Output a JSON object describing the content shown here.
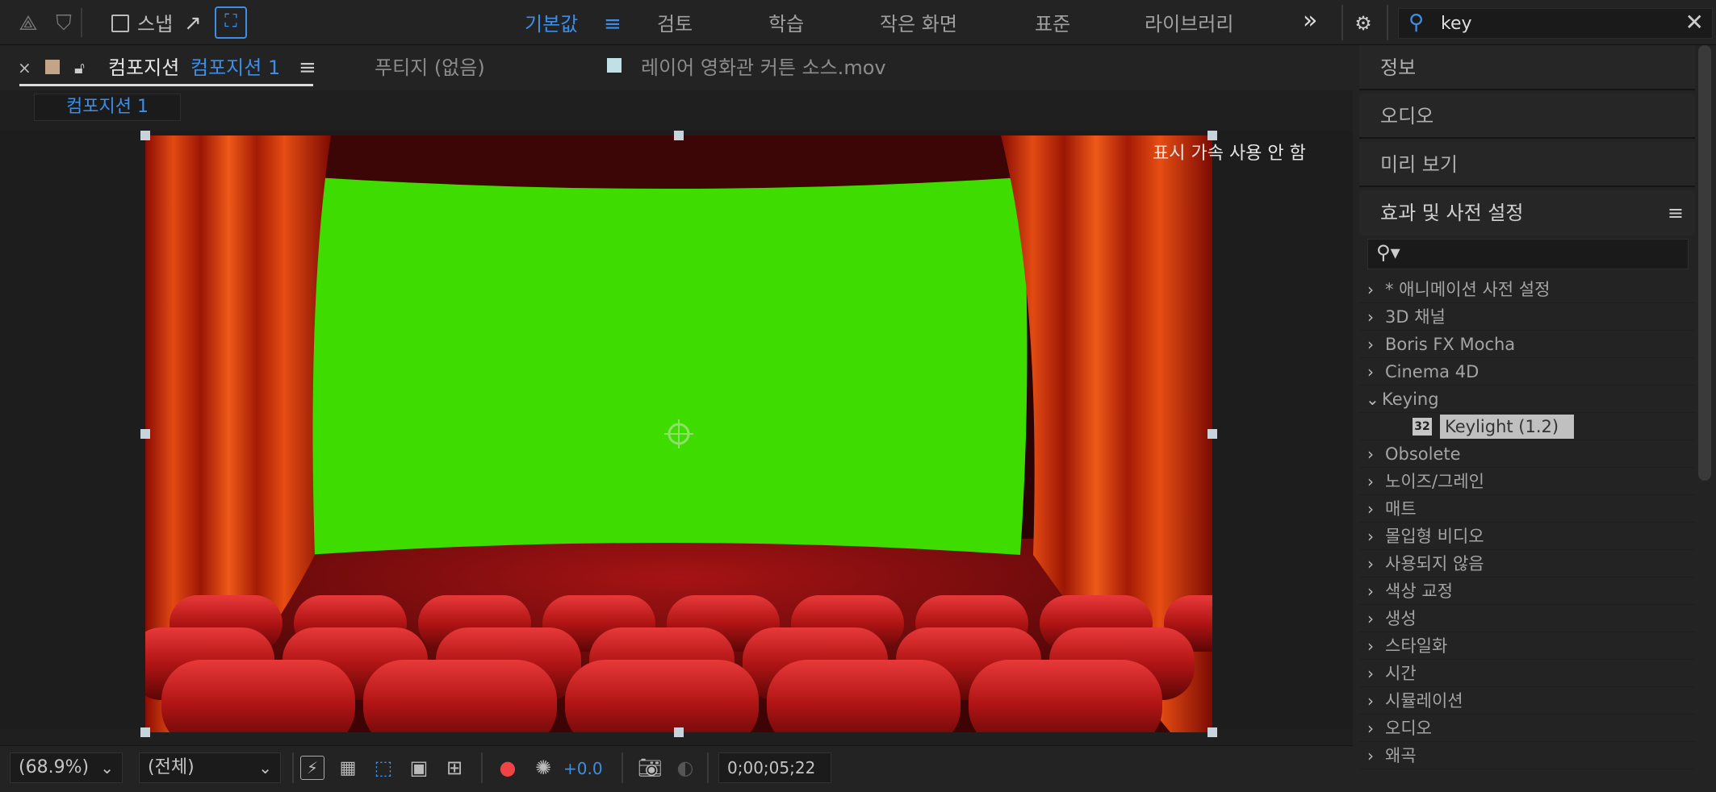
{
  "toolbar": {
    "snap_label": "스냅",
    "workspaces": [
      "기본값",
      "검토",
      "학습",
      "작은 화면",
      "표준",
      "라이브러리"
    ],
    "active_workspace": "기본값",
    "more_label": "»",
    "search_value": "key"
  },
  "comp_panel": {
    "tab_name": "컴포지션",
    "tab_comp": "컴포지션 1",
    "footage_tab": "푸티지 (없음)",
    "layer_tab": "레이어 영화관 커튼 소스.mov",
    "sub_tab": "컴포지션 1",
    "accel_note": "표시 가속 사용 안 함",
    "zoom": "(68.9%)",
    "resolution": "(전체)",
    "exposure": "+0.0",
    "timecode": "0;00;05;22"
  },
  "right_panel": {
    "sections": [
      "정보",
      "오디오",
      "미리 보기"
    ],
    "effects_title": "효과 및 사전 설정",
    "effects_tree": [
      {
        "label": "* 애니메이션 사전 설정",
        "expanded": false
      },
      {
        "label": "3D 채널",
        "expanded": false
      },
      {
        "label": "Boris FX Mocha",
        "expanded": false
      },
      {
        "label": "Cinema 4D",
        "expanded": false
      },
      {
        "label": "Keying",
        "expanded": true
      },
      {
        "label": "Keylight (1.2)",
        "child": true,
        "badge": "32"
      },
      {
        "label": "Obsolete",
        "expanded": false
      },
      {
        "label": "노이즈/그레인",
        "expanded": false
      },
      {
        "label": "매트",
        "expanded": false
      },
      {
        "label": "몰입형 비디오",
        "expanded": false
      },
      {
        "label": "사용되지 않음",
        "expanded": false
      },
      {
        "label": "색상 교정",
        "expanded": false
      },
      {
        "label": "생성",
        "expanded": false
      },
      {
        "label": "스타일화",
        "expanded": false
      },
      {
        "label": "시간",
        "expanded": false
      },
      {
        "label": "시뮬레이션",
        "expanded": false
      },
      {
        "label": "오디오",
        "expanded": false
      },
      {
        "label": "왜곡",
        "expanded": false
      }
    ]
  },
  "colors": {
    "accent": "#3d8ee6",
    "screen_green": "#3fdc00",
    "curtain_red": "#c0220a"
  }
}
